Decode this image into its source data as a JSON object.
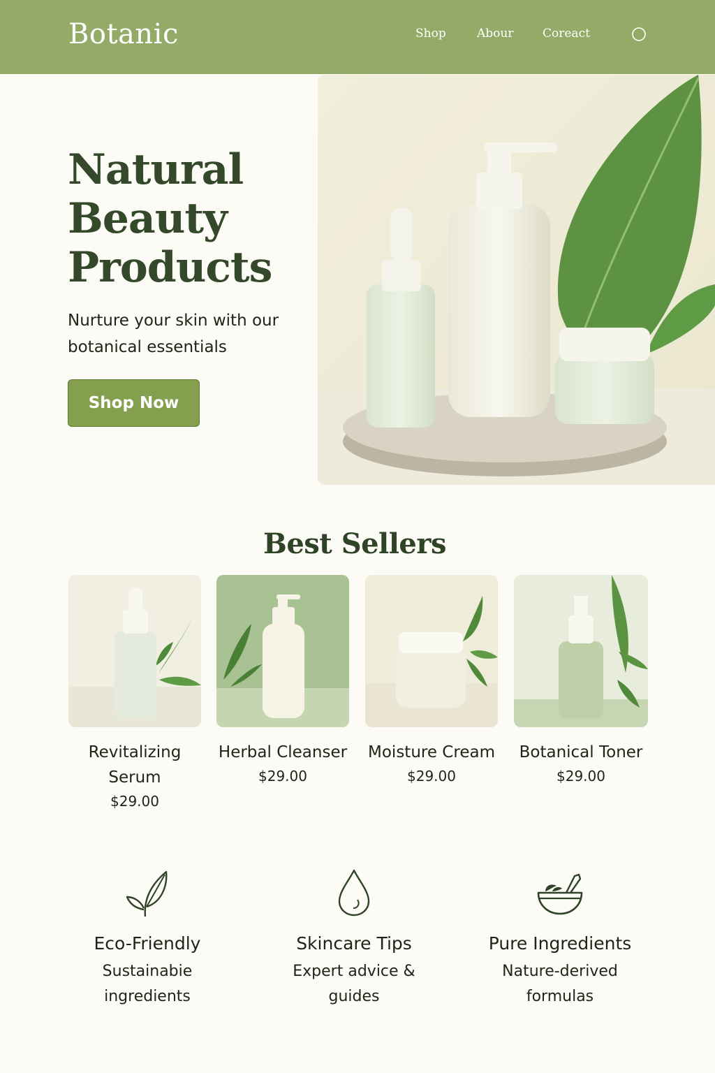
{
  "header": {
    "brand": "Botanic",
    "nav": [
      "Shop",
      "Abour",
      "Coreact"
    ],
    "search_icon": "search-icon",
    "bg_color": "#94ab68"
  },
  "hero": {
    "title": "Natural Beauty Products",
    "subtitle": "Nurture your skin with our botanical essentials",
    "cta": "Shop Now",
    "accent": "#84a04f"
  },
  "best_sellers": {
    "title": "Best Sellers",
    "products": [
      {
        "name": "Revitalizing Serum",
        "price": "$29.00"
      },
      {
        "name": "Herbal Cleanser",
        "price": "$29.00"
      },
      {
        "name": "Moisture Cream",
        "price": "$29.00"
      },
      {
        "name": "Botanical Toner",
        "price": "$29.00"
      }
    ]
  },
  "features": [
    {
      "icon": "leaf-icon",
      "title": "Eco-Friendly",
      "desc": "Sustainabie ingredients"
    },
    {
      "icon": "droplet-icon",
      "title": "Skincare Tips",
      "desc": "Expert advice & guides"
    },
    {
      "icon": "mortar-pestle-icon",
      "title": "Pure Ingredients",
      "desc": "Nature-derived formulas"
    }
  ]
}
